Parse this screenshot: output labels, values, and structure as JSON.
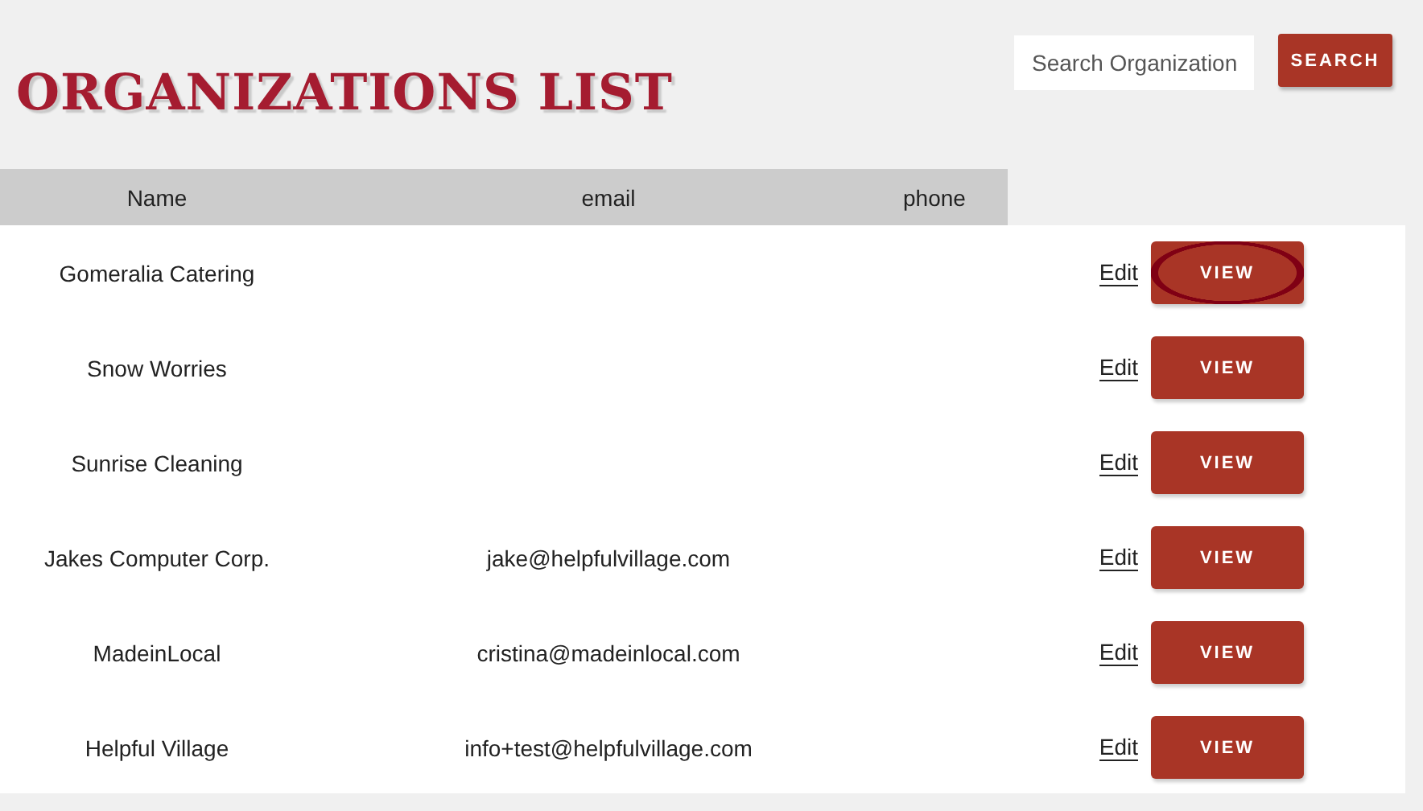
{
  "title": "ORGANIZATIONS LIST",
  "search": {
    "placeholder": "Search Organization",
    "button": "SEARCH"
  },
  "table": {
    "columns": [
      "Name",
      "email",
      "phone"
    ],
    "rows": [
      {
        "name": "Gomeralia Catering",
        "edit": "Edit",
        "view": "VIEW",
        "focused": true
      },
      {
        "name": "Snow Worries",
        "edit": "Edit",
        "view": "VIEW",
        "focused": false
      },
      {
        "name": "Sunrise Cleaning",
        "edit": "Edit",
        "view": "VIEW",
        "focused": false
      },
      {
        "name": "Jakes Computer Corp.",
        "email": "jake@helpfulvillage.com",
        "edit": "Edit",
        "view": "VIEW",
        "focused": false
      },
      {
        "name": "MadeinLocal",
        "email": "cristina@madeinlocal.com",
        "edit": "Edit",
        "view": "VIEW",
        "focused": false
      },
      {
        "name": "Helpful Village",
        "email": "info+test@helpfulvillage.com",
        "edit": "Edit",
        "view": "VIEW",
        "focused": false
      }
    ]
  }
}
